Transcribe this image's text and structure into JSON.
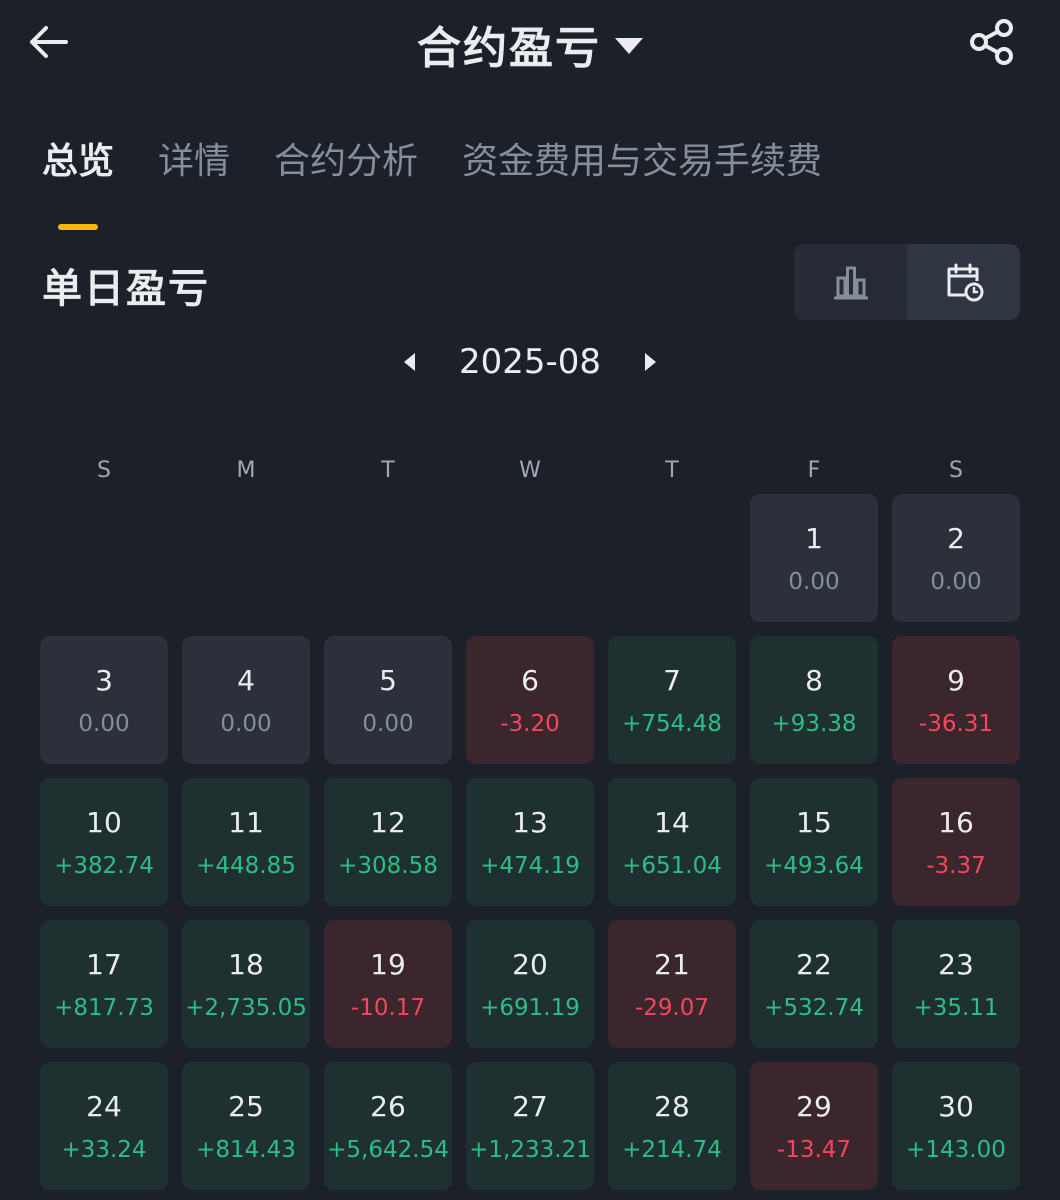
{
  "header": {
    "title": "合约盈亏",
    "back_icon": "arrow-left-icon",
    "share_icon": "share-icon"
  },
  "tabs": [
    {
      "label": "总览",
      "active": true
    },
    {
      "label": "详情",
      "active": false
    },
    {
      "label": "合约分析",
      "active": false
    },
    {
      "label": "资金费用与交易手续费",
      "active": false
    }
  ],
  "section": {
    "title": "单日盈亏",
    "view_toggle": [
      {
        "icon": "bar-chart-icon",
        "active": false
      },
      {
        "icon": "calendar-clock-icon",
        "active": true
      }
    ]
  },
  "month_nav": {
    "label": "2025-08"
  },
  "weekdays": [
    "S",
    "M",
    "T",
    "W",
    "T",
    "F",
    "S"
  ],
  "calendar": {
    "leading_blank_days": 5,
    "days": [
      {
        "day": "1",
        "value": "0.00",
        "status": "zero"
      },
      {
        "day": "2",
        "value": "0.00",
        "status": "zero"
      },
      {
        "day": "3",
        "value": "0.00",
        "status": "zero"
      },
      {
        "day": "4",
        "value": "0.00",
        "status": "zero"
      },
      {
        "day": "5",
        "value": "0.00",
        "status": "zero"
      },
      {
        "day": "6",
        "value": "-3.20",
        "status": "neg"
      },
      {
        "day": "7",
        "value": "+754.48",
        "status": "pos"
      },
      {
        "day": "8",
        "value": "+93.38",
        "status": "pos"
      },
      {
        "day": "9",
        "value": "-36.31",
        "status": "neg"
      },
      {
        "day": "10",
        "value": "+382.74",
        "status": "pos"
      },
      {
        "day": "11",
        "value": "+448.85",
        "status": "pos"
      },
      {
        "day": "12",
        "value": "+308.58",
        "status": "pos"
      },
      {
        "day": "13",
        "value": "+474.19",
        "status": "pos"
      },
      {
        "day": "14",
        "value": "+651.04",
        "status": "pos"
      },
      {
        "day": "15",
        "value": "+493.64",
        "status": "pos"
      },
      {
        "day": "16",
        "value": "-3.37",
        "status": "neg"
      },
      {
        "day": "17",
        "value": "+817.73",
        "status": "pos"
      },
      {
        "day": "18",
        "value": "+2,735.05",
        "status": "pos"
      },
      {
        "day": "19",
        "value": "-10.17",
        "status": "neg"
      },
      {
        "day": "20",
        "value": "+691.19",
        "status": "pos"
      },
      {
        "day": "21",
        "value": "-29.07",
        "status": "neg"
      },
      {
        "day": "22",
        "value": "+532.74",
        "status": "pos"
      },
      {
        "day": "23",
        "value": "+35.11",
        "status": "pos"
      },
      {
        "day": "24",
        "value": "+33.24",
        "status": "pos"
      },
      {
        "day": "25",
        "value": "+814.43",
        "status": "pos"
      },
      {
        "day": "26",
        "value": "+5,642.54",
        "status": "pos"
      },
      {
        "day": "27",
        "value": "+1,233.21",
        "status": "pos"
      },
      {
        "day": "28",
        "value": "+214.74",
        "status": "pos"
      },
      {
        "day": "29",
        "value": "-13.47",
        "status": "neg"
      },
      {
        "day": "30",
        "value": "+143.00",
        "status": "pos"
      }
    ]
  },
  "colors": {
    "background": "#1c2028",
    "accent": "#f0b90b",
    "positive": "#2ebd85",
    "negative": "#f6465d",
    "neutral": "#848e9c"
  }
}
